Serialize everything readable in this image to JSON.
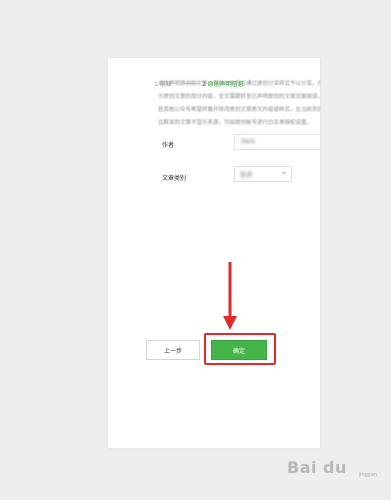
{
  "steps": {
    "step1": "1 须知",
    "step2": "2 原创声明信息"
  },
  "description": {
    "lines": [
      "成功声明原创的文章，其他公众号可通过原创分享样式予以分享。在分享页",
      "示原创文章的部分内容，全文需跳转至已声明原创的文章页面阅读。",
      "若其他公众号希望转载并修改原创文章原文内容或样式，在当前页面阅读全",
      "且群发的文章不显示来源，可由原创帐号进行白名单授权设置。"
    ]
  },
  "form": {
    "author_label": "作者",
    "author_value": "Sara",
    "category_label": "文章类别",
    "category_value": "生活"
  },
  "buttons": {
    "prev": "上一步",
    "confirm": "确定"
  },
  "colors": {
    "accent_green": "#44b549",
    "highlight_red": "#e12b2b"
  },
  "watermark": {
    "brand": "Bai du",
    "sub": "jingyan"
  }
}
